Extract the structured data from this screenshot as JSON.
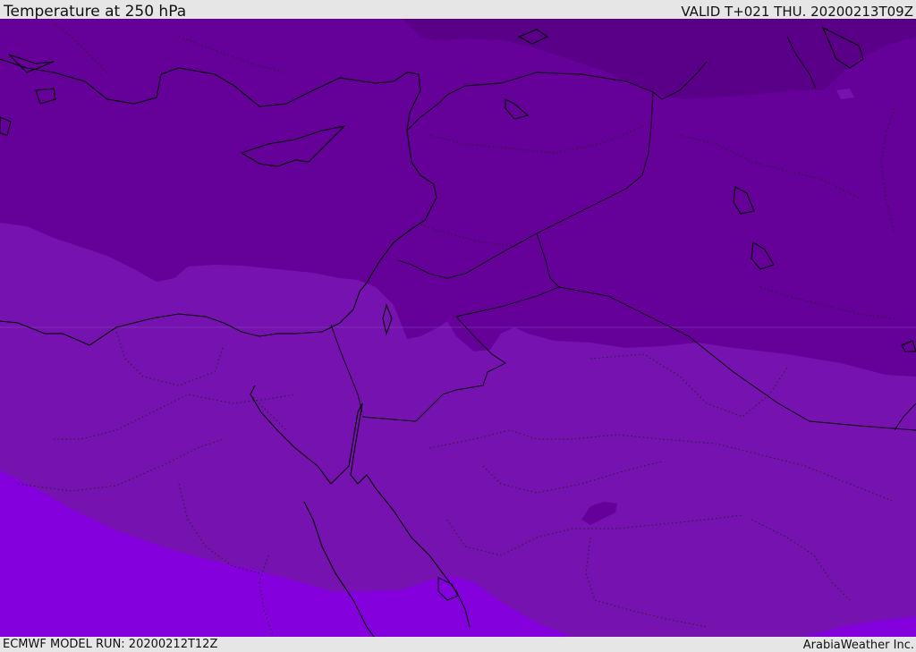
{
  "header": {
    "title": "Temperature at 250 hPa",
    "valid": "VALID T+021 THU. 20200213T09Z"
  },
  "footer": {
    "model_run": "ECMWF MODEL RUN: 20200212T12Z",
    "credit": "ArabiaWeather Inc."
  },
  "map": {
    "colors": {
      "coldest_band": "#5a0088",
      "cold_band": "#650099",
      "mid_band": "#7612b0",
      "warm_band": "#8400dd",
      "coastline": "#000000",
      "border": "#000000"
    },
    "icons": [
      "map-canvas"
    ]
  }
}
